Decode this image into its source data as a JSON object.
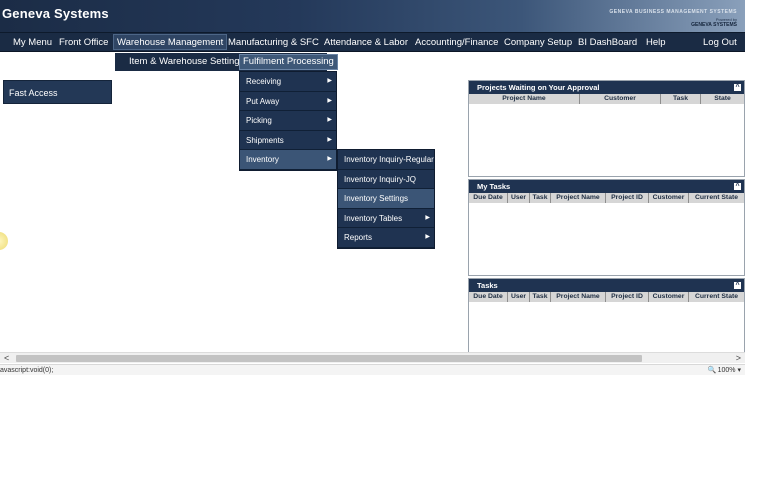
{
  "app": {
    "title": "Geneva Systems",
    "brand_line1": "GENEVA BUSINESS MANAGEMENT SYSTEMS",
    "brand_line2": "Powered by",
    "brand_line3": "GENEVA SYSTEMS"
  },
  "menu": {
    "items": [
      {
        "label": "My Menu"
      },
      {
        "label": "Front Office"
      },
      {
        "label": "Warehouse Management"
      },
      {
        "label": "Manufacturing & SFC"
      },
      {
        "label": "Attendance & Labor"
      },
      {
        "label": "Accounting/Finance"
      },
      {
        "label": "Company Setup"
      },
      {
        "label": "BI DashBoard"
      },
      {
        "label": "Help"
      }
    ],
    "logout": "Log Out"
  },
  "submenu": {
    "items": [
      {
        "label": "Item & Warehouse Settings"
      },
      {
        "label": "Fulfilment Processing"
      }
    ]
  },
  "dropdown1": {
    "items": [
      {
        "label": "Receiving"
      },
      {
        "label": "Put Away"
      },
      {
        "label": "Picking"
      },
      {
        "label": "Shipments"
      },
      {
        "label": "Inventory"
      }
    ]
  },
  "dropdown2": {
    "items": [
      {
        "label": "Inventory Inquiry-Regular"
      },
      {
        "label": "Inventory Inquiry-JQ"
      },
      {
        "label": "Inventory Settings"
      },
      {
        "label": "Inventory Tables"
      },
      {
        "label": "Reports"
      }
    ]
  },
  "fast_access": {
    "label": "Fast Access"
  },
  "panels": {
    "approval": {
      "title": "Projects Waiting on Your Approval",
      "columns": [
        "Project Name",
        "Customer",
        "Task",
        "State"
      ]
    },
    "my_tasks": {
      "title": "My Tasks",
      "columns": [
        "Due Date",
        "User",
        "Task",
        "Project Name",
        "Project ID",
        "Customer",
        "Current State"
      ]
    },
    "tasks": {
      "title": "Tasks",
      "columns": [
        "Due Date",
        "User",
        "Task",
        "Project Name",
        "Project ID",
        "Customer",
        "Current State"
      ]
    }
  },
  "status": {
    "text": "avascript:void(0);",
    "zoom": "100%"
  },
  "colors": {
    "nav_bg": "#1a2b44",
    "panel_header": "#1f3351",
    "active_item": "#3b5576"
  }
}
